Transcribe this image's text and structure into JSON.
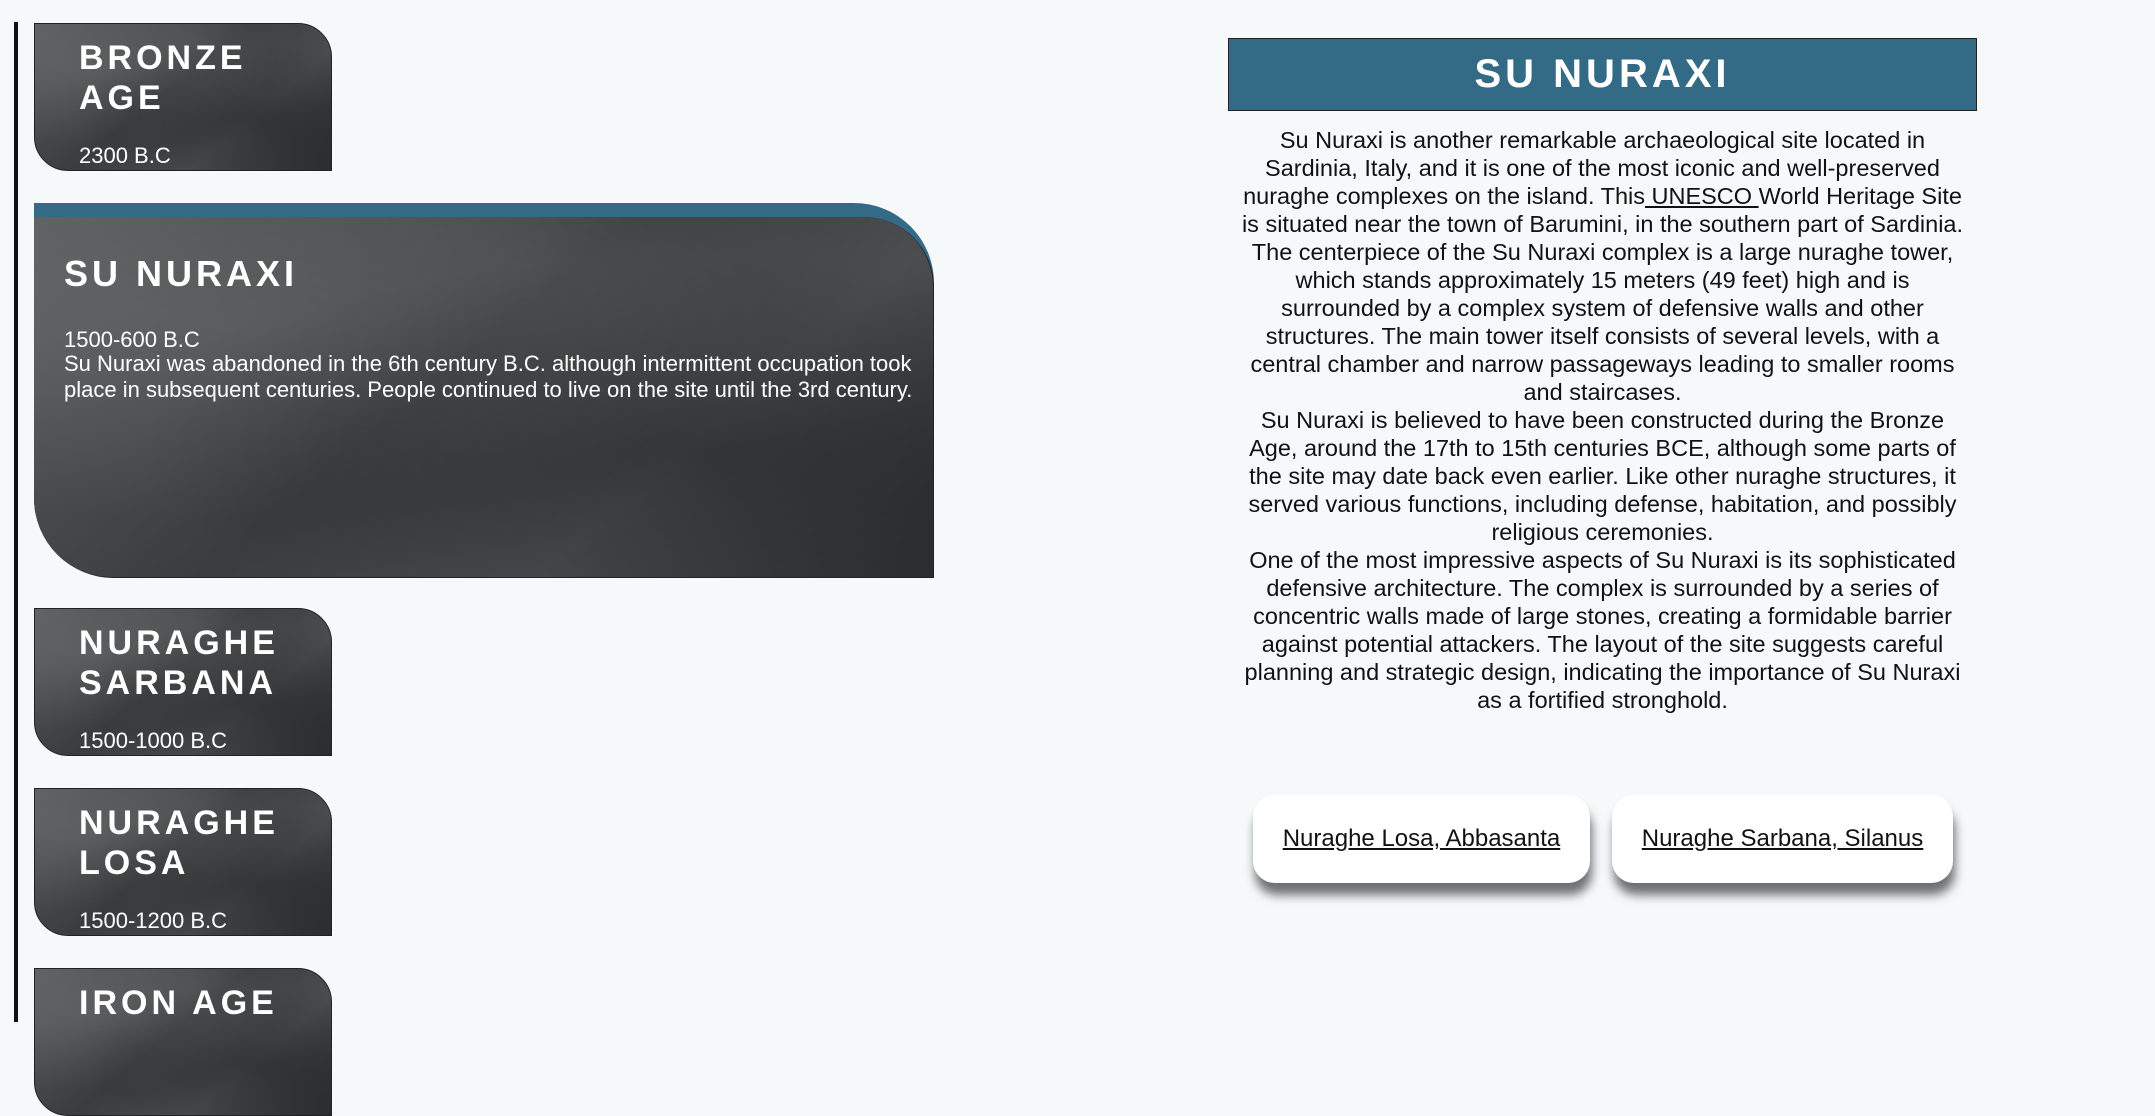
{
  "timeline": {
    "periods": [
      {
        "title": "BRONZE\nAGE",
        "date": "2300 B.C"
      },
      {
        "title": "NURAGHE\nSARBANA",
        "date": "1500-1000 B.C"
      },
      {
        "title": "NURAGHE\nLOSA",
        "date": "1500-1200 B.C"
      },
      {
        "title": "IRON AGE",
        "date": ""
      }
    ],
    "active": {
      "title": "SU NURAXI",
      "date": "1500-600 B.C",
      "description": "Su Nuraxi was abandoned in the 6th century B.C. although intermittent occupation took place in subsequent centuries. People continued to live on the site until the 3rd century."
    }
  },
  "detail": {
    "title": "SU NURAXI",
    "p1_before": "Su Nuraxi is another remarkable archaeological site located in Sardinia, Italy, and it is one of the most iconic and well-preserved nuraghe complexes on the island. This",
    "p1_link": " UNESCO ",
    "p1_after": "World Heritage Site is situated near the town of Barumini, in the southern part of Sardinia.",
    "p2": "The centerpiece of the Su Nuraxi complex is a large nuraghe tower, which stands approximately 15 meters (49 feet) high and is surrounded by a complex system of defensive walls and other structures. The main tower itself consists of several levels, with a central chamber and narrow passageways leading to smaller rooms and staircases.",
    "p3": "Su Nuraxi is believed to have been constructed during the Bronze Age, around the 17th to 15th centuries BCE, although some parts of the site may date back even earlier. Like other nuraghe structures, it served various functions, including defense, habitation, and possibly religious ceremonies.",
    "p4": "One of the most impressive aspects of Su Nuraxi is its sophisticated defensive architecture. The complex is surrounded by a series of concentric walls made of large stones, creating a formidable barrier against potential attackers. The layout of the site suggests careful planning and strategic design, indicating the importance of Su Nuraxi as a fortified stronghold."
  },
  "related": {
    "link1": "Nuraghe Losa, Abbasanta",
    "link2": "Nuraghe Sarbana, Silanus"
  },
  "colors": {
    "accent": "#336a85",
    "background": "#f5f9fa"
  }
}
